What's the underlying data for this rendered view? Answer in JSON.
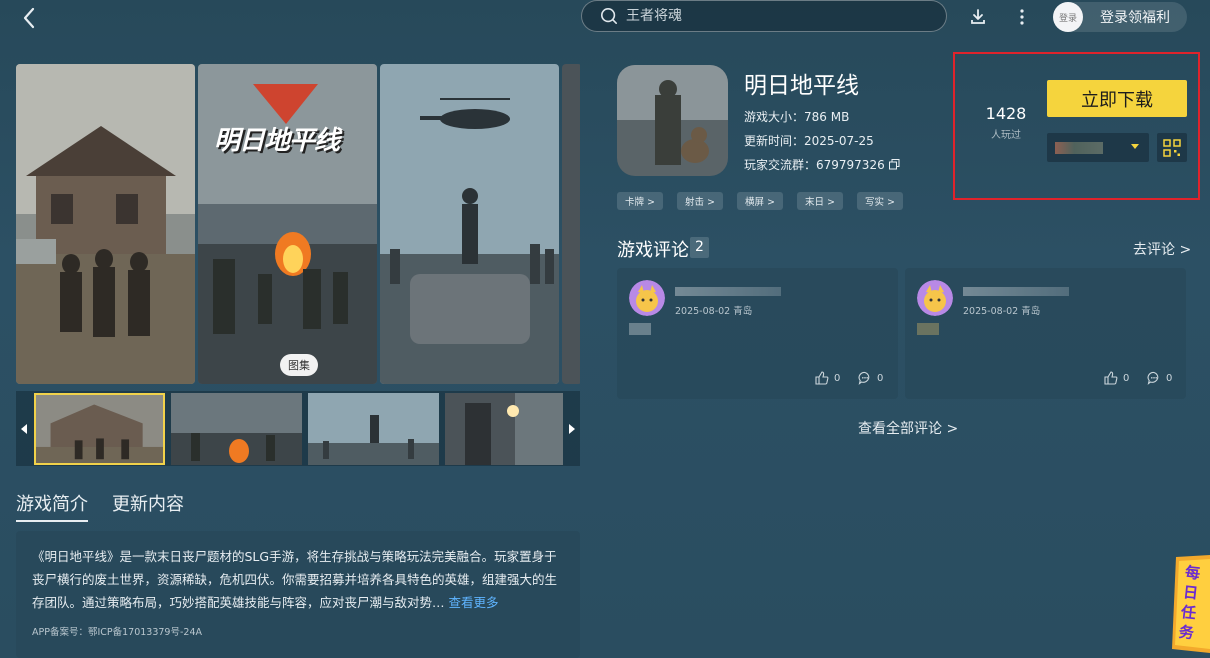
{
  "header": {
    "search_placeholder": "王者将魂",
    "login_avatar_text": "登录",
    "login_label": "登录领福利"
  },
  "gallery": {
    "album_label": "图集",
    "poster_logo_text": "明日地平线"
  },
  "intro": {
    "tabs": [
      "游戏简介",
      "更新内容"
    ],
    "description": "《明日地平线》是一款末日丧尸题材的SLG手游，将生存挑战与策略玩法完美融合。玩家置身于丧尸横行的废土世界，资源稀缺，危机四伏。你需要招募并培养各具特色的英雄，组建强大的生存团队。通过策略布局，巧妙搭配英雄技能与阵容，应对丧尸潮与敌对势…",
    "more_label": "查看更多",
    "icp": "APP备案号：鄂ICP备17013379号-24A"
  },
  "game": {
    "title": "明日地平线",
    "size_line": "游戏大小：786 MB",
    "update_line": "更新时间：2025-07-25",
    "group_line": "玩家交流群：679797326",
    "tags": [
      "卡牌 >",
      "射击 >",
      "横屏 >",
      "末日 >",
      "写实 >"
    ]
  },
  "download": {
    "play_count": "1428",
    "play_label": "人玩过",
    "button_label": "立即下载"
  },
  "comments": {
    "title": "游戏评论",
    "count": "2",
    "go_label": "去评论 >",
    "items": [
      {
        "date_loc": "2025-08-02 青岛",
        "likes": "0",
        "replies": "0"
      },
      {
        "date_loc": "2025-08-02 青岛",
        "likes": "0",
        "replies": "0"
      }
    ],
    "view_all": "查看全部评论 >"
  },
  "daily_task": {
    "text": "每日任务"
  },
  "colors": {
    "accent_yellow": "#f5d43d",
    "highlight_red": "#e0232b",
    "link_blue": "#5fb4ff"
  }
}
